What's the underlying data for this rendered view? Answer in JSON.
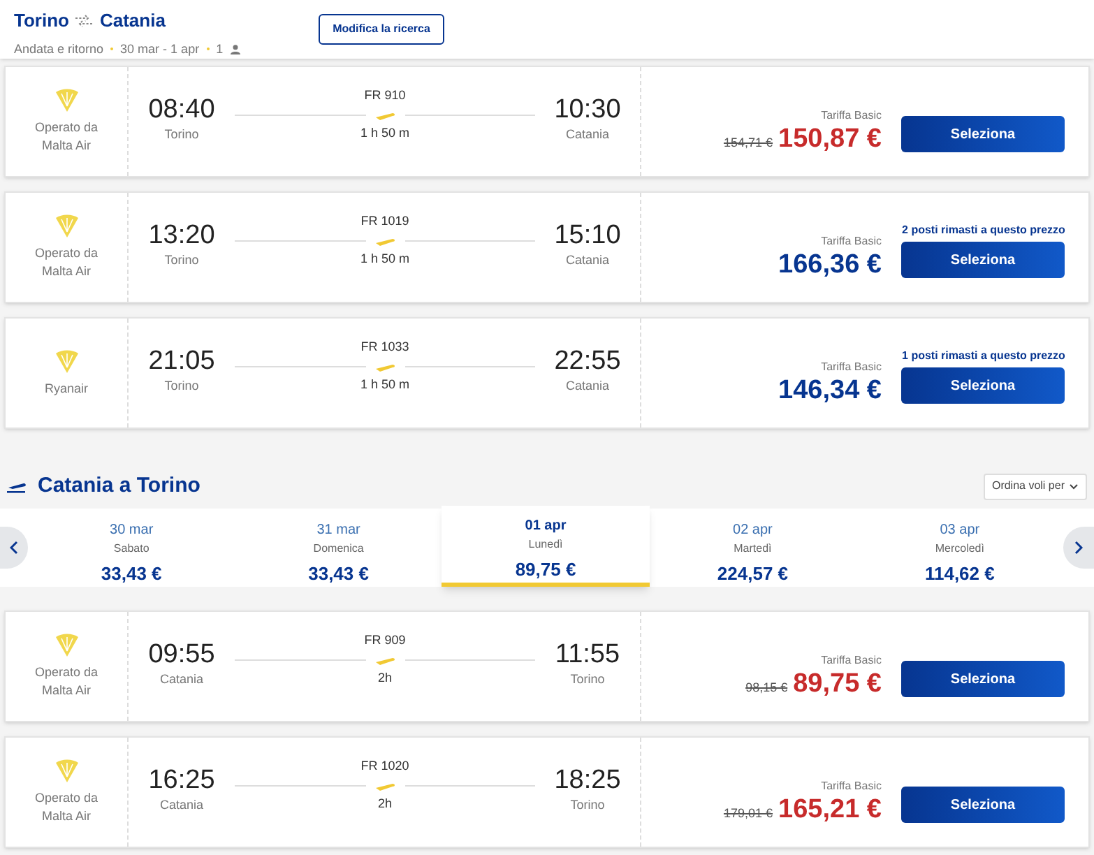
{
  "header": {
    "origin": "Torino",
    "destination": "Catania",
    "trip_type": "Andata e ritorno",
    "dates": "30 mar - 1 apr",
    "passengers": "1",
    "edit_button": "Modifica la ricerca"
  },
  "outbound_flights": [
    {
      "carrier": "Operato da Malta Air",
      "depart_time": "08:40",
      "depart_city": "Torino",
      "flight_no": "FR 910",
      "duration": "1 h 50 m",
      "arrive_time": "10:30",
      "arrive_city": "Catania",
      "fare": "Tariffa Basic",
      "old_price": "154,71 €",
      "price": "150,87 €",
      "button": "Seleziona"
    },
    {
      "carrier": "Operato da Malta Air",
      "depart_time": "13:20",
      "depart_city": "Torino",
      "flight_no": "FR 1019",
      "duration": "1 h 50 m",
      "arrive_time": "15:10",
      "arrive_city": "Catania",
      "fare": "Tariffa Basic",
      "price": "166,36 €",
      "seats_note": "2 posti rimasti a questo prezzo",
      "button": "Seleziona"
    },
    {
      "carrier": "Ryanair",
      "depart_time": "21:05",
      "depart_city": "Torino",
      "flight_no": "FR 1033",
      "duration": "1 h 50 m",
      "arrive_time": "22:55",
      "arrive_city": "Catania",
      "fare": "Tariffa Basic",
      "price": "146,34 €",
      "seats_note": "1 posti rimasti a questo prezzo",
      "button": "Seleziona"
    }
  ],
  "return_section": {
    "title": "Catania a Torino",
    "sort_label": "Ordina voli per"
  },
  "dates": [
    {
      "date": "30 mar",
      "weekday": "Sabato",
      "price": "33,43 €",
      "selected": false
    },
    {
      "date": "31 mar",
      "weekday": "Domenica",
      "price": "33,43 €",
      "selected": false
    },
    {
      "date": "01 apr",
      "weekday": "Lunedì",
      "price": "89,75 €",
      "selected": true
    },
    {
      "date": "02 apr",
      "weekday": "Martedì",
      "price": "224,57 €",
      "selected": false
    },
    {
      "date": "03 apr",
      "weekday": "Mercoledì",
      "price": "114,62 €",
      "selected": false
    }
  ],
  "return_flights": [
    {
      "carrier": "Operato da Malta Air",
      "depart_time": "09:55",
      "depart_city": "Catania",
      "flight_no": "FR 909",
      "duration": "2h",
      "arrive_time": "11:55",
      "arrive_city": "Torino",
      "fare": "Tariffa Basic",
      "old_price": "98,15 €",
      "price": "89,75 €",
      "button": "Seleziona"
    },
    {
      "carrier": "Operato da Malta Air",
      "depart_time": "16:25",
      "depart_city": "Catania",
      "flight_no": "FR 1020",
      "duration": "2h",
      "arrive_time": "18:25",
      "arrive_city": "Torino",
      "fare": "Tariffa Basic",
      "old_price": "179,01 €",
      "price": "165,21 €",
      "button": "Seleziona"
    }
  ]
}
